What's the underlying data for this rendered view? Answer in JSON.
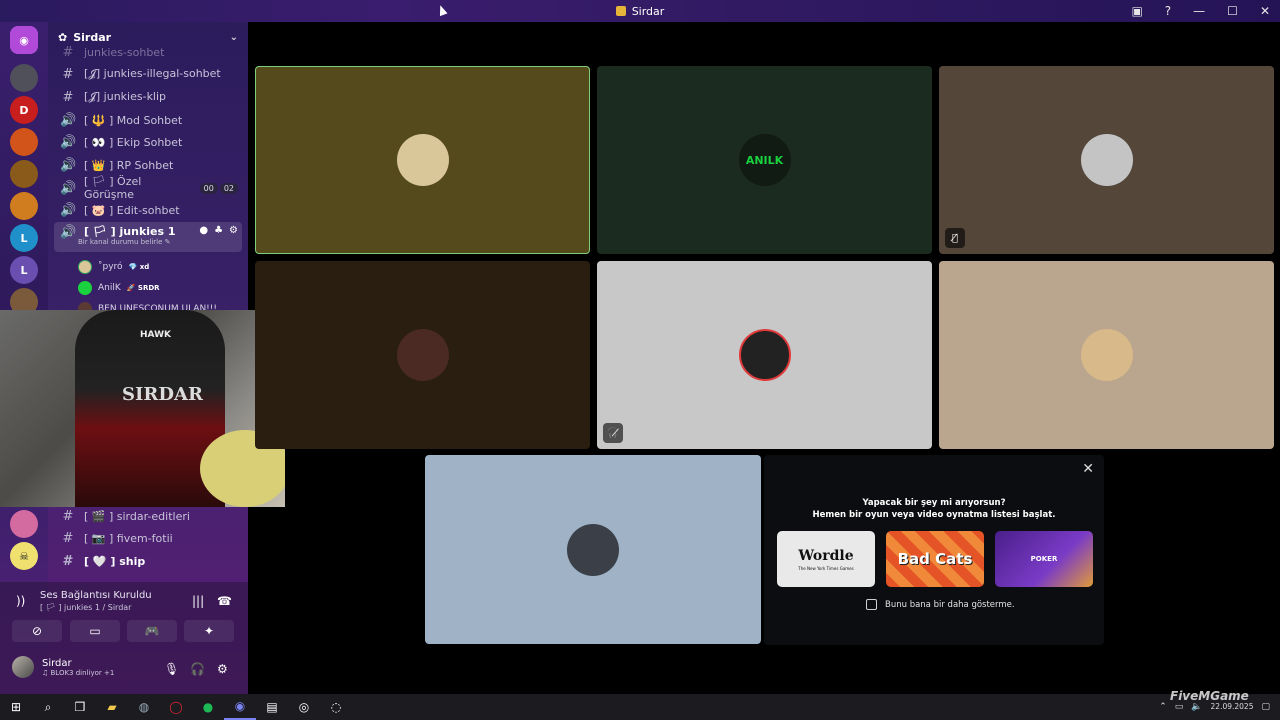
{
  "window": {
    "title": "Sirdar"
  },
  "server": {
    "name": "Sirdar"
  },
  "channels": [
    {
      "sym": "#",
      "label": "junkies-sohbet"
    },
    {
      "sym": "#",
      "label": "[𝓙] junkies-illegal-sohbet"
    },
    {
      "sym": "#",
      "label": "[𝓙] junkies-klip"
    },
    {
      "sym": "🔊",
      "label": "[ 🔱 ] Mod Sohbet"
    },
    {
      "sym": "🔊",
      "label": "[ 👀 ] Ekip Sohbet"
    },
    {
      "sym": "🔊",
      "label": "[ 👑 ] RP Sohbet"
    },
    {
      "sym": "🔊",
      "label": "[ 🏳 ] Özel Görüşme",
      "badge": [
        "00",
        "02"
      ]
    },
    {
      "sym": "🔊",
      "label": "[ 🐷 ] Edit-sohbet"
    }
  ],
  "active_channel": {
    "label": "[ 🏳 ] junkies 1",
    "status": "Bir kanal durumu belirle ✎"
  },
  "voice_users": [
    {
      "name": "˚pyró",
      "tag": "💎 xd"
    },
    {
      "name": "AnilK",
      "tag": "🚀 SRDR"
    },
    {
      "name": "BEN UNESCONUM ULAN!!!",
      "tag": ""
    }
  ],
  "lower_channels": [
    {
      "sym": "#",
      "label": "[ 🎬 ] sirdar-editleri"
    },
    {
      "sym": "#",
      "label": "[ 📷 ] fivem-fotii"
    },
    {
      "sym": "#",
      "label": "[ 🤍 ] ship"
    }
  ],
  "voice_panel": {
    "status": "Ses Bağlantısı Kuruldu",
    "channel": "[ 🏳 ] junkies 1 / Sirdar"
  },
  "user": {
    "name": "Sirdar",
    "status": "♫ BLOK3 dinliyor +1"
  },
  "webcam": {
    "chair_text": "SIRDAR",
    "brand": "HAWK"
  },
  "tiles": [
    {
      "bg": "#544a1c",
      "avatar": "#d9c79a",
      "label": "",
      "mute": false,
      "border": "#7ed07e"
    },
    {
      "bg": "#1b2b20",
      "avatar": "#1ad13e",
      "label": "ANILK",
      "mute": false
    },
    {
      "bg": "#54473a",
      "avatar": "#c4c4c4",
      "label": "",
      "mute": true
    },
    {
      "bg": "#2a1e10",
      "avatar": "#4a2a22",
      "label": "",
      "mute": false
    },
    {
      "bg": "#c8c8c8",
      "avatar": "#222222",
      "label": "",
      "mute": true
    },
    {
      "bg": "#baa58e",
      "avatar": "#d8b98a",
      "label": "",
      "mute": false
    },
    {
      "bg": "#9fb2c6",
      "avatar": "#3a3f48",
      "label": "",
      "mute": false
    }
  ],
  "activity": {
    "line1": "Yapacak bir şey mi arıyorsun?",
    "line2": "Hemen bir oyun veya video oynatma listesi başlat.",
    "cards": [
      {
        "title": "Wordle",
        "sub": "The New York Times Games"
      },
      {
        "title": "Bad Cats",
        "sub": ""
      },
      {
        "title": "POKER",
        "sub": ""
      }
    ],
    "checkbox": "Bunu bana bir daha gösterme."
  },
  "taskbar": {
    "date": "22.09.2025"
  },
  "watermark": "FiveMGame"
}
